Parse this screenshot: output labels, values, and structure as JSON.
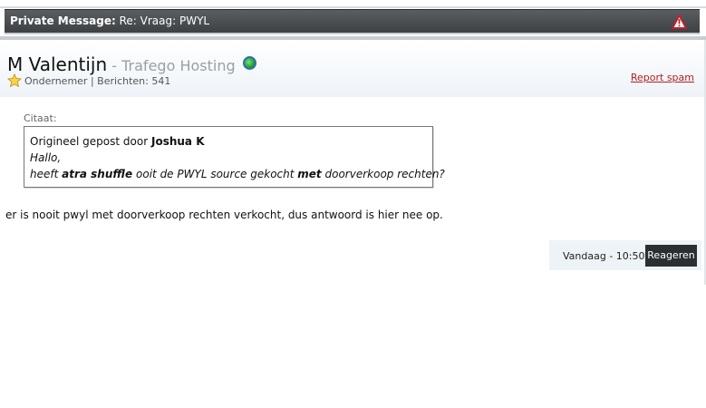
{
  "header": {
    "title_prefix": "Private Message:",
    "title_subject": "Re: Vraag: PWYL",
    "warning_icon": "warning-triangle-icon",
    "accent_color": "#c0202b"
  },
  "author": {
    "name": "M Valentijn",
    "separator": " - ",
    "company": "Trafego Hosting",
    "status_icon": "online-status-icon",
    "rank_icon": "star-icon",
    "rank": "Ondernemer",
    "meta_sep": " | ",
    "posts_label": "Berichten:",
    "posts_count": "541",
    "report_label": "Report spam"
  },
  "quote": {
    "label": "Citaat:",
    "posted_by_prefix": "Origineel gepost door",
    "posted_by_user": "Joshua K",
    "line1": "Hallo,",
    "line2_a": "heeft",
    "line2_b": "atra shuffle",
    "line2_c": "ooit de PWYL source gekocht",
    "line2_d": "met",
    "line2_e": "doorverkoop rechten?"
  },
  "post": {
    "body": "er is nooit pwyl met doorverkoop rechten verkocht, dus antwoord is hier nee op.",
    "timestamp": "Vandaag - 10:50",
    "reply_label": "Reageren"
  }
}
